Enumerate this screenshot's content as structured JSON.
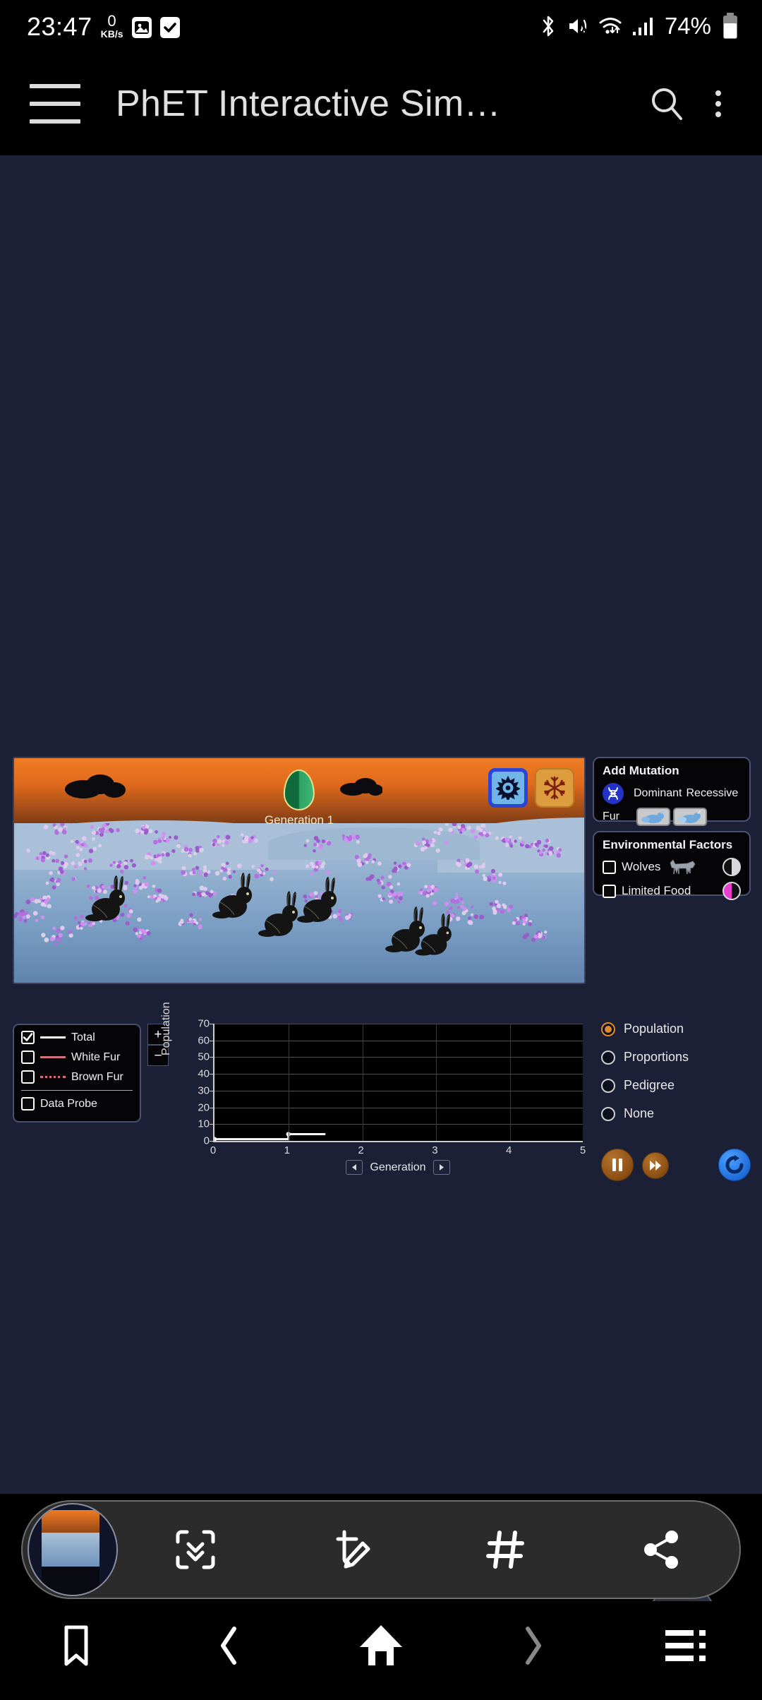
{
  "status_bar": {
    "time": "23:47",
    "network_speed_value": "0",
    "network_speed_unit": "KB/s",
    "icons": [
      "gallery-icon",
      "checkmark-icon",
      "bluetooth-icon",
      "mute-icon",
      "wifi-icon",
      "signal-icon"
    ],
    "battery_percent": "74%"
  },
  "app_header": {
    "title": "PhET Interactive Sim…",
    "menu_icon": "hamburger-icon",
    "search_icon": "search-icon",
    "overflow_icon": "more-vertical-icon"
  },
  "simulation": {
    "environment": {
      "generation_label": "Generation 1",
      "climate": {
        "sun_label": "sun-icon",
        "snow_label": "snowflake-icon",
        "selected": "sun"
      }
    },
    "add_mutation": {
      "title": "Add Mutation",
      "dna_icon": "dna-icon",
      "col_dominant": "Dominant",
      "col_recessive": "Recessive",
      "rows": [
        {
          "label": "Fur",
          "dominant_icon": "brown-fur-rabbit-icon",
          "recessive_icon": "white-fur-rabbit-icon"
        }
      ]
    },
    "environmental_factors": {
      "title": "Environmental Factors",
      "items": [
        {
          "label": "Wolves",
          "checked": false,
          "icon": "wolf-icon",
          "pie": "half-gray-pie"
        },
        {
          "label": "Limited Food",
          "checked": false,
          "icon": "",
          "pie": "half-magenta-pie"
        }
      ]
    },
    "legend": {
      "items": [
        {
          "label": "Total",
          "checked": true,
          "color": "#ffffff",
          "style": "solid"
        },
        {
          "label": "White Fur",
          "checked": false,
          "color": "#d4707f",
          "style": "solid"
        },
        {
          "label": "Brown Fur",
          "checked": false,
          "color": "#d4707f",
          "style": "dotted"
        }
      ],
      "data_probe": {
        "label": "Data Probe",
        "checked": false
      }
    },
    "zoom_controls": {
      "zoom_in": "+",
      "zoom_out": "−"
    },
    "graph_mode": {
      "options": [
        {
          "label": "Population",
          "selected": true
        },
        {
          "label": "Proportions",
          "selected": false
        },
        {
          "label": "Pedigree",
          "selected": false
        },
        {
          "label": "None",
          "selected": false
        }
      ],
      "accent_color": "#e08a2e"
    },
    "playback": {
      "pause_icon": "pause-icon",
      "fast_forward_icon": "fast-forward-icon",
      "reset_icon": "reset-icon"
    }
  },
  "chart_data": {
    "type": "line",
    "title": "",
    "xlabel": "Generation",
    "ylabel": "Population",
    "xlim": [
      0,
      5
    ],
    "ylim": [
      0,
      70
    ],
    "xticks": [
      0,
      1,
      2,
      3,
      4,
      5
    ],
    "yticks": [
      0,
      10,
      20,
      30,
      40,
      50,
      60,
      70
    ],
    "grid": true,
    "legend_position": "left-panel",
    "series": [
      {
        "name": "Total",
        "color": "#ffffff",
        "style": "solid",
        "step": true,
        "x": [
          0,
          1,
          1,
          1.5
        ],
        "y": [
          1,
          1,
          4,
          4
        ]
      },
      {
        "name": "White Fur",
        "color": "#d4707f",
        "style": "solid",
        "x": [],
        "y": []
      },
      {
        "name": "Brown Fur",
        "color": "#d4707f",
        "style": "dotted",
        "x": [],
        "y": []
      }
    ],
    "x_nav": {
      "prev": "◀",
      "next": "▶"
    }
  },
  "fab": {
    "icon": "text-scan-icon"
  },
  "screenshot_toolbar": {
    "thumbnail": "screenshot-preview",
    "buttons": [
      {
        "name": "scroll-capture-icon"
      },
      {
        "name": "edit-icon"
      },
      {
        "name": "tag-icon"
      },
      {
        "name": "share-icon"
      }
    ]
  },
  "nav_bar": {
    "buttons": [
      {
        "name": "bookmark-icon",
        "enabled": true
      },
      {
        "name": "back-icon",
        "enabled": true
      },
      {
        "name": "home-icon",
        "enabled": true
      },
      {
        "name": "forward-icon",
        "enabled": false
      },
      {
        "name": "tabs-menu-icon",
        "enabled": true
      }
    ]
  }
}
